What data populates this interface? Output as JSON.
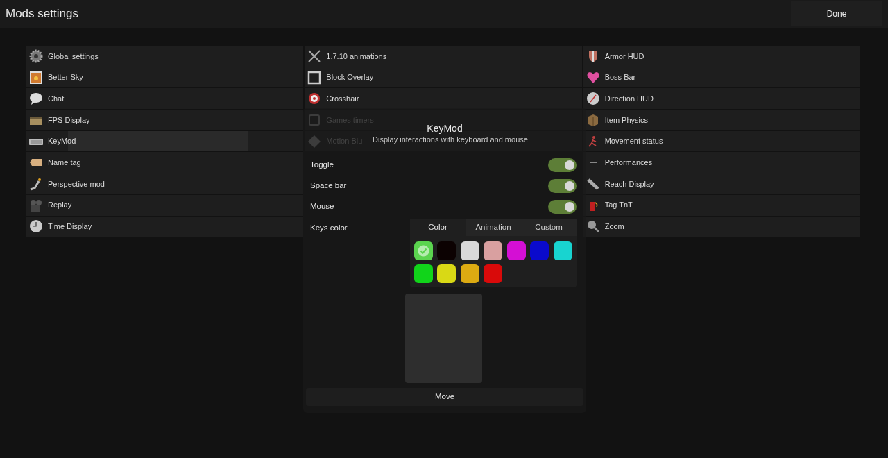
{
  "header": {
    "title": "Mods settings",
    "done_button": "Done"
  },
  "columns": [
    [
      {
        "label": "Global settings",
        "selected": false
      },
      {
        "label": "Better Sky",
        "selected": false
      },
      {
        "label": "Chat",
        "selected": false
      },
      {
        "label": "FPS Display",
        "selected": false
      },
      {
        "label": "KeyMod",
        "selected": true
      },
      {
        "label": "Name tag",
        "selected": false
      },
      {
        "label": "Perspective mod",
        "selected": false
      },
      {
        "label": "Replay",
        "selected": false
      },
      {
        "label": "Time Display",
        "selected": false
      }
    ],
    [
      {
        "label": "1.7.10 animations",
        "selected": false
      },
      {
        "label": "Block Overlay",
        "selected": false
      },
      {
        "label": "Crosshair",
        "selected": false
      },
      {
        "label": "Games timers",
        "selected": false
      },
      {
        "label": "Motion Blu",
        "selected": false
      }
    ],
    [
      {
        "label": "Armor HUD",
        "selected": false
      },
      {
        "label": "Boss Bar",
        "selected": false
      },
      {
        "label": "Direction HUD",
        "selected": false
      },
      {
        "label": "Item Physics",
        "selected": false
      },
      {
        "label": "Movement status",
        "selected": false
      },
      {
        "label": "Performances",
        "selected": false
      },
      {
        "label": "Reach Display",
        "selected": false
      },
      {
        "label": "Tag TnT",
        "selected": false
      },
      {
        "label": "Zoom",
        "selected": false
      }
    ]
  ],
  "dialog": {
    "title": "KeyMod",
    "subtitle": "Display interactions with keyboard and mouse",
    "settings": [
      {
        "label": "Toggle",
        "on": true
      },
      {
        "label": "Space bar",
        "on": true
      },
      {
        "label": "Mouse",
        "on": true
      }
    ],
    "keys_color": {
      "label": "Keys color",
      "tabs": [
        {
          "label": "Color",
          "selected": true
        },
        {
          "label": "Animation",
          "selected": false
        },
        {
          "label": "Custom",
          "selected": false
        }
      ],
      "swatches": [
        {
          "color": "#5bd44f",
          "selected": true
        },
        {
          "color": "#0c0202",
          "selected": false
        },
        {
          "color": "#d9d9d9",
          "selected": false
        },
        {
          "color": "#d9a0a0",
          "selected": false
        },
        {
          "color": "#d40fd4",
          "selected": false
        },
        {
          "color": "#0a0acc",
          "selected": false
        },
        {
          "color": "#18d4d0",
          "selected": false
        },
        {
          "color": "#11d41a",
          "selected": false
        },
        {
          "color": "#d9d915",
          "selected": false
        },
        {
          "color": "#dcaa12",
          "selected": false
        },
        {
          "color": "#d90a0a",
          "selected": false
        }
      ]
    },
    "move_button": "Move"
  }
}
